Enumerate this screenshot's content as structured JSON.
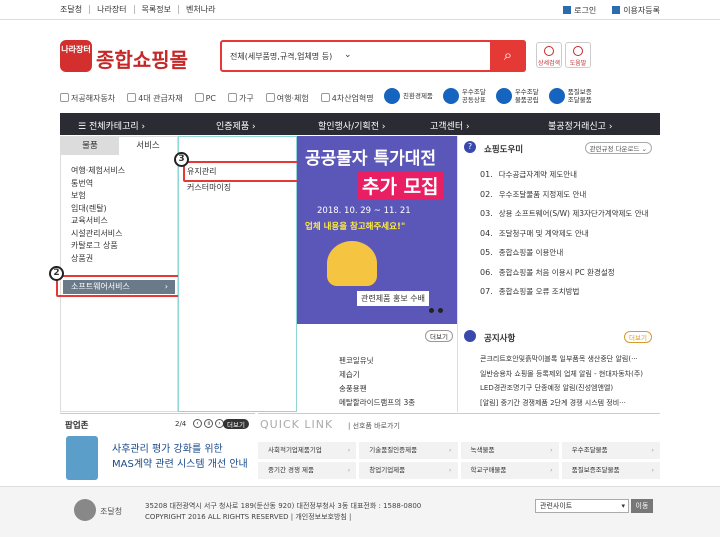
{
  "top": {
    "links": [
      "조달청",
      "나라장터",
      "목록정보",
      "벤처나라"
    ],
    "login": "로그인",
    "register": "이용자등록"
  },
  "logo": {
    "badge": "나라장터",
    "text": "종합쇼핑몰"
  },
  "search": {
    "select_value": "전체(세부품명,규격,업체명 등)",
    "input_value": "",
    "button_icon": "search-icon"
  },
  "side_buttons": [
    "상세검색",
    "도움말"
  ],
  "quick_links": [
    "저공해자동차",
    "4대 관급자재",
    "PC",
    "가구",
    "여행·체험",
    "4차산업혁명"
  ],
  "certs": [
    "친환경제품",
    "우수조달\n공동상표",
    "우수조달\n물품공립",
    "품질보증\n조달물품"
  ],
  "nav": {
    "all_category": "전체카테고리",
    "items": [
      "인증제품",
      "할인행사/기획전",
      "고객센터",
      "불공정거래신고"
    ]
  },
  "left": {
    "tabs": [
      "물품",
      "서비스"
    ],
    "categories": [
      "여행·체험서비스",
      "통번역",
      "보험",
      "임대(렌탈)",
      "교육서비스",
      "시설관리서비스",
      "카탈로그 상품",
      "상품권"
    ],
    "selected": "소프트웨어서비스"
  },
  "submenu": {
    "items": [
      "유지관리",
      "커스터마이징"
    ]
  },
  "badges": [
    "2",
    "3"
  ],
  "banner": {
    "line1": "공공물자 특가대전",
    "line2": "추가 모집",
    "date": "2018. 10. 29 ~ 11. 21",
    "note": "업체 내용을 참고해주세요!\"",
    "caption": "관련제품 홍보 수배"
  },
  "below_banner": {
    "more": "더보기",
    "items": [
      "펜코일유닛",
      "제습기",
      "송풍용팬",
      "메탈할라이드램프의 3종"
    ]
  },
  "helper": {
    "title": "쇼핑도우미",
    "dropdown": "관련규정 다운로드",
    "items": [
      {
        "num": "01.",
        "text": "다수공급자계약 제도안내"
      },
      {
        "num": "02.",
        "text": "우수조달물품 지정제도 안내"
      },
      {
        "num": "03.",
        "text": "상용 소프트웨어(S/W) 제3자단가계약제도 안내"
      },
      {
        "num": "04.",
        "text": "조달청구매 및 계약제도 안내"
      },
      {
        "num": "05.",
        "text": "종합쇼핑몰 이용안내"
      },
      {
        "num": "06.",
        "text": "종합쇼핑몰 처음 이용시 PC 환경설정"
      },
      {
        "num": "07.",
        "text": "종합쇼핑몰 오류 조치방법"
      }
    ]
  },
  "notice": {
    "title": "공지사항",
    "more": "더보기",
    "items": [
      "콘크리트호안및흙막이블록 일부품목 생산중단 알림(···",
      "일반승용차 쇼핑몰 등록제외 업체 알림 - 현대자동차(주)",
      "LED경관조명기구 단종예정 알림(진성엠앤엘)",
      "[알림] 중기간 경쟁제품 2단계 경쟁 시스템 정비···"
    ]
  },
  "popup": {
    "title": "팝업존",
    "page": "2/4",
    "more": "더보기",
    "line1": "사후관리 평가 강화를 위한",
    "line2": "MAS계약 관련 시스템 개선 안내"
  },
  "quicklink": {
    "title": "QUICK LINK",
    "subtitle": "| 선호품 바로가기",
    "items": [
      "사회적기업제품기업",
      "기술품질인증제품",
      "녹색물품",
      "우수조달물품",
      "중기간 경쟁 제품",
      "창업기업제품",
      "학교구매물품",
      "품질보증조달물품"
    ]
  },
  "footer": {
    "logo_text": "조달청",
    "address": "35208 대전광역시 서구 청사로 189(둔산동 920) 대전정부청사 3동 대표전화 : 1588-0800",
    "copyright": "COPYRIGHT 2016 ALL RIGHTS RESERVED | 개인정보보호방침 |",
    "select": "관련사이트",
    "go": "이동"
  }
}
